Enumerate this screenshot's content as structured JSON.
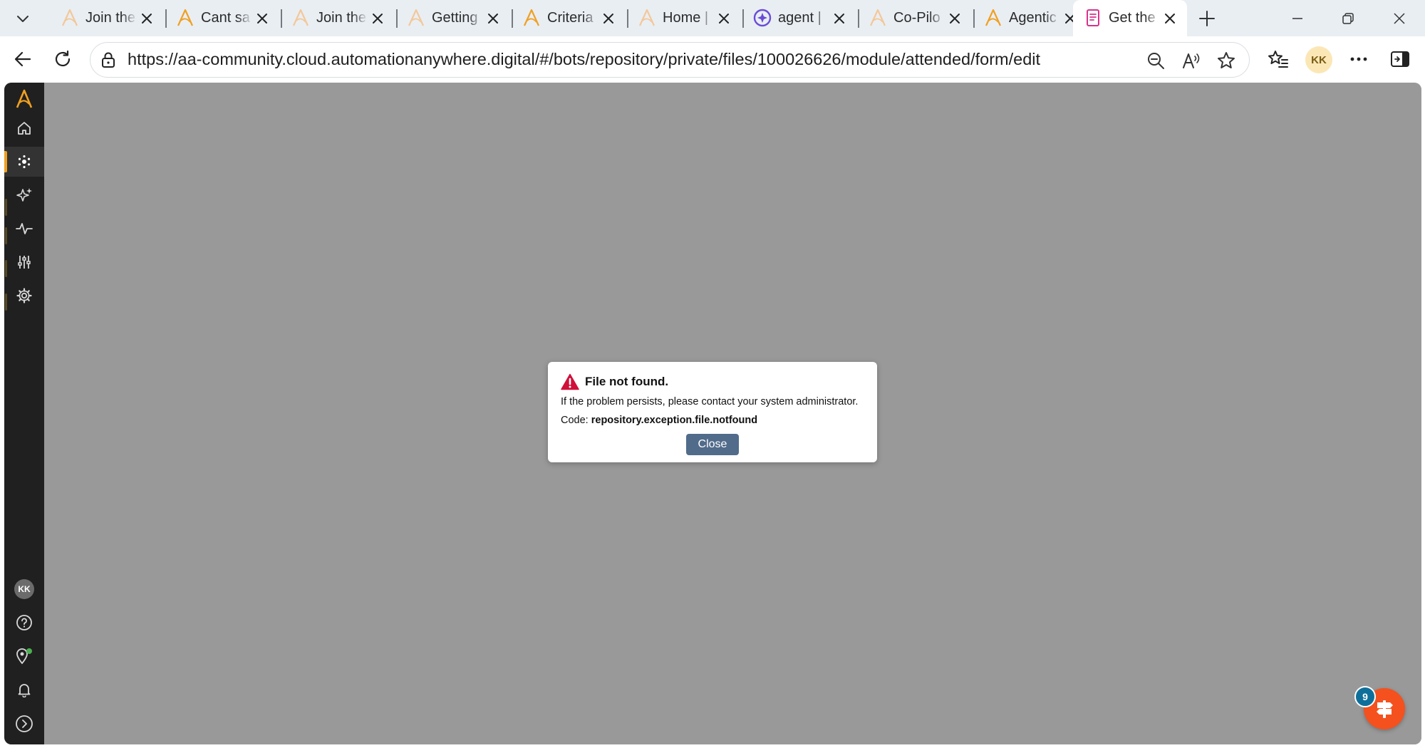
{
  "browser": {
    "tabs": [
      {
        "title": "Join the",
        "icon": "automation-anywhere-logo-icon",
        "active": false
      },
      {
        "title": "Cant sa",
        "icon": "automation-anywhere-logo-icon",
        "active": false
      },
      {
        "title": "Join the",
        "icon": "automation-anywhere-logo-icon",
        "active": false
      },
      {
        "title": "Getting",
        "icon": "automation-anywhere-logo-icon",
        "active": false
      },
      {
        "title": "Criteria",
        "icon": "automation-anywhere-logo-icon",
        "active": false
      },
      {
        "title": "Home |",
        "icon": "automation-anywhere-logo-icon",
        "active": false
      },
      {
        "title": "agent |",
        "icon": "copilot-icon",
        "active": false
      },
      {
        "title": "Co-Pilo",
        "icon": "automation-anywhere-logo-icon",
        "active": false
      },
      {
        "title": "Agentic",
        "icon": "automation-anywhere-logo-icon",
        "active": false
      },
      {
        "title": "Get the",
        "icon": "form-document-icon",
        "active": true
      }
    ],
    "url": "https://aa-community.cloud.automationanywhere.digital/#/bots/repository/private/files/100026626/module/attended/form/edit",
    "profile_initials": "KK"
  },
  "sidebar": {
    "items": [
      {
        "icon": "aa-logo-icon"
      },
      {
        "icon": "home-icon"
      },
      {
        "icon": "automation-icon",
        "active": true
      },
      {
        "icon": "ai-sparkle-icon"
      },
      {
        "icon": "activity-pulse-icon"
      },
      {
        "icon": "manage-sliders-icon"
      },
      {
        "icon": "settings-gear-icon"
      }
    ],
    "bottom": {
      "avatar_initials": "KK",
      "items": [
        "help-icon",
        "pathfinder-location-icon",
        "notifications-bell-icon",
        "expand-chevron-icon"
      ]
    }
  },
  "dialog": {
    "title": "File not found.",
    "message": "If the problem persists, please contact your system administrator.",
    "code_label": "Code:",
    "code_value": "repository.exception.file.notfound",
    "close_label": "Close"
  },
  "help_fab": {
    "badge_count": "9"
  },
  "colors": {
    "accent": "#f0a021",
    "dialog_button": "#516b8b",
    "warning": "#d0103a",
    "overlay": "#999999",
    "sidebar": "#202020",
    "fab": "#f4511e",
    "badge": "#0f6f9b"
  }
}
